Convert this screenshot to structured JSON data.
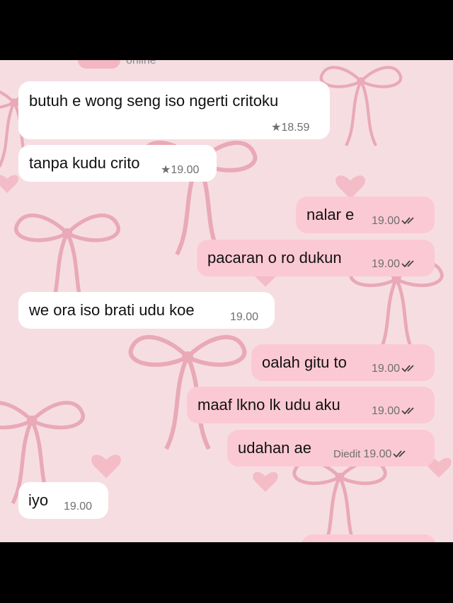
{
  "header": {
    "status_partial": "online"
  },
  "messages": [
    {
      "dir": "in",
      "text": "butuh e wong seng iso ngerti critoku",
      "time": "★18.59"
    },
    {
      "dir": "in",
      "text": "tanpa kudu crito",
      "time": "★19.00"
    },
    {
      "dir": "out",
      "text": "nalar e",
      "time": "19.00"
    },
    {
      "dir": "out",
      "text": "pacaran o ro dukun",
      "time": "19.00"
    },
    {
      "dir": "in",
      "text": "we ora iso brati udu koe",
      "time": "19.00"
    },
    {
      "dir": "out",
      "text": "oalah gitu to",
      "time": "19.00"
    },
    {
      "dir": "out",
      "text": "maaf lkno lk udu aku",
      "time": "19.00"
    },
    {
      "dir": "out",
      "text": "udahan ae",
      "edited": "Diedit",
      "time": "19.00"
    },
    {
      "dir": "in",
      "text": "iyo",
      "time": "19.00"
    }
  ],
  "icons": {
    "read_receipt": "double-check-icon",
    "wallpaper": "pink-bow-heart-pattern"
  },
  "colors": {
    "wallpaper": "#f6dde2",
    "incoming_bubble": "#ffffff",
    "outgoing_bubble": "#fbc9d4",
    "bow": "#e9a9b6",
    "heart": "#f4bcc6",
    "meta": "#6f6f6f"
  }
}
